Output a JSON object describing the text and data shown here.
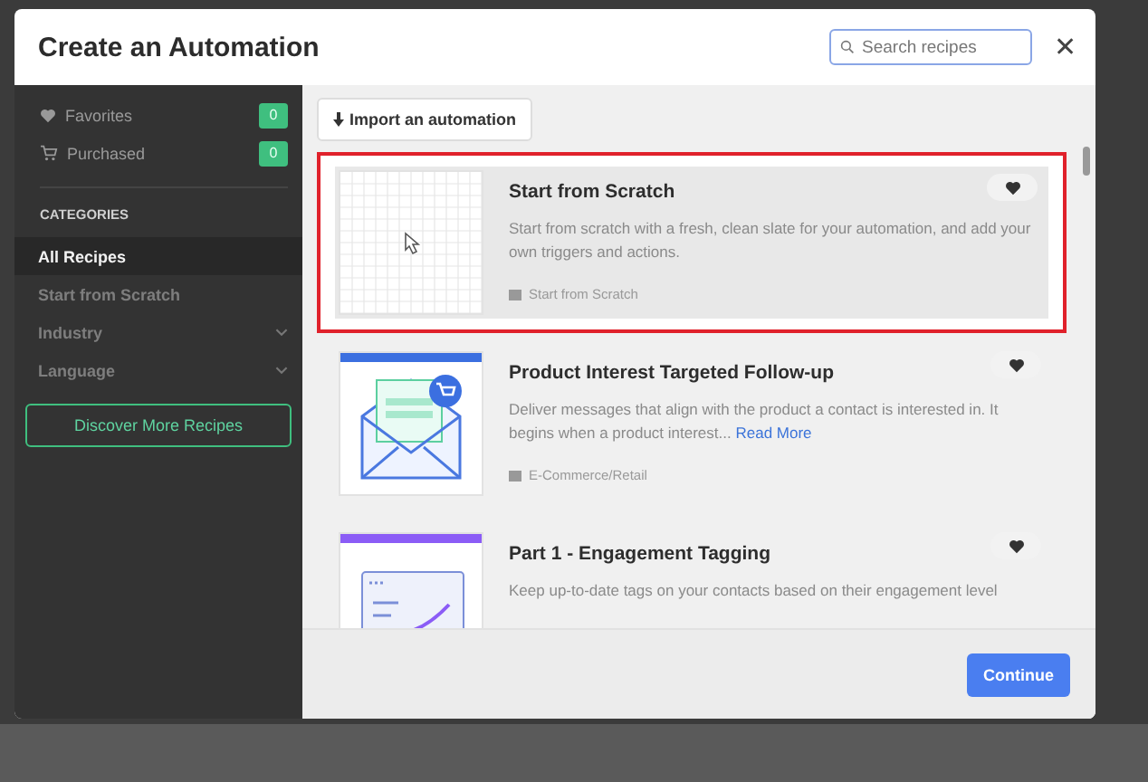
{
  "dialog": {
    "title": "Create an Automation",
    "search": {
      "placeholder": "Search recipes"
    },
    "close": "✕"
  },
  "sidebar": {
    "items": [
      {
        "label": "Favorites",
        "kind": "favorites",
        "count": "0"
      },
      {
        "label": "Purchased",
        "kind": "purchased",
        "count": "0"
      }
    ],
    "categories_heading": "CATEGORIES",
    "categories": [
      {
        "label": "All Recipes",
        "selected": true,
        "expandable": false
      },
      {
        "label": "Start from Scratch",
        "selected": false,
        "expandable": false
      },
      {
        "label": "Industry",
        "selected": false,
        "expandable": true
      },
      {
        "label": "Language",
        "selected": false,
        "expandable": true
      }
    ],
    "discover_button": "Discover More Recipes"
  },
  "import_button": "Import an automation",
  "recipes": [
    {
      "kind": "scratch",
      "title": "Start from Scratch",
      "description": "Start from scratch with a fresh, clean slate for your automation, and add your own triggers and actions.",
      "category": "Start from Scratch",
      "highlighted": true,
      "hovered": true
    },
    {
      "kind": "email",
      "title": "Product Interest Targeted Follow-up",
      "description": "Deliver messages that align with the product a contact is interested in. It begins when a product interest...",
      "link": "Read More",
      "category": "E-Commerce/Retail",
      "highlighted": false,
      "hovered": false,
      "color": "#3b6fe0"
    },
    {
      "kind": "tagging",
      "title": "Part 1 - Engagement Tagging",
      "description": "Keep up-to-date tags on your contacts based on their engagement level",
      "highlighted": false,
      "hovered": false,
      "color": "#8b5cf6"
    }
  ],
  "continue_button": "Continue"
}
